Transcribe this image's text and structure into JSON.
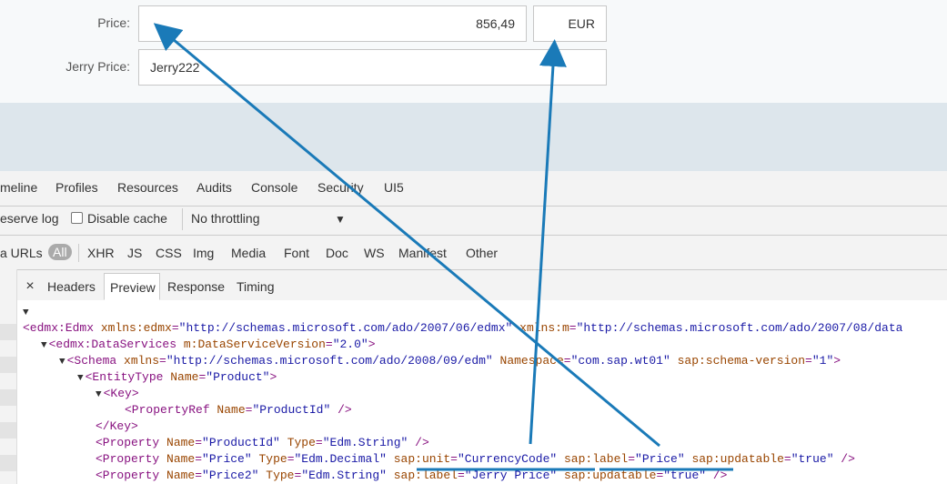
{
  "form": {
    "price_label": "Price:",
    "price_value": "856,49",
    "currency_value": "EUR",
    "jerry_price_label": "Jerry Price:",
    "jerry_price_value": "Jerry222"
  },
  "devtools": {
    "panel_tabs": [
      "meline",
      "Profiles",
      "Resources",
      "Audits",
      "Console",
      "Security",
      "UI5"
    ],
    "toolbar": {
      "preserve_log": "eserve log",
      "disable_cache": "Disable cache",
      "throttling": "No throttling",
      "dropdown_glyph": "▼"
    },
    "filters": {
      "data_urls": "a URLs",
      "all": "All",
      "types": [
        "XHR",
        "JS",
        "CSS",
        "Img",
        "Media",
        "Font",
        "Doc",
        "WS",
        "Manifest",
        "Other"
      ]
    },
    "detail_tabs": {
      "close_glyph": "×",
      "headers": "Headers",
      "preview": "Preview",
      "response": "Response",
      "timing": "Timing"
    }
  },
  "xml_lines": [
    {
      "indent": 0,
      "tri": "▼",
      "parts": []
    },
    {
      "indent": 0,
      "tri": "",
      "parts": [
        {
          "c": "tag",
          "t": "<edmx:Edmx "
        },
        {
          "c": "an",
          "t": "xmlns:edmx"
        },
        {
          "c": "tag",
          "t": "="
        },
        {
          "c": "av",
          "t": "\"http://schemas.microsoft.com/ado/2007/06/edmx\""
        },
        {
          "c": "tag",
          "t": " "
        },
        {
          "c": "an",
          "t": "xmlns:m"
        },
        {
          "c": "tag",
          "t": "="
        },
        {
          "c": "av",
          "t": "\"http://schemas.microsoft.com/ado/2007/08/data"
        }
      ]
    },
    {
      "indent": 1,
      "tri": "▼",
      "parts": [
        {
          "c": "tag",
          "t": "<edmx:DataServices "
        },
        {
          "c": "an",
          "t": "m:DataServiceVersion"
        },
        {
          "c": "tag",
          "t": "="
        },
        {
          "c": "av",
          "t": "\"2.0\""
        },
        {
          "c": "tag",
          "t": ">"
        }
      ]
    },
    {
      "indent": 2,
      "tri": "▼",
      "parts": [
        {
          "c": "tag",
          "t": "<Schema "
        },
        {
          "c": "an",
          "t": "xmlns"
        },
        {
          "c": "tag",
          "t": "="
        },
        {
          "c": "av",
          "t": "\"http://schemas.microsoft.com/ado/2008/09/edm\""
        },
        {
          "c": "tag",
          "t": " "
        },
        {
          "c": "an",
          "t": "Namespace"
        },
        {
          "c": "tag",
          "t": "="
        },
        {
          "c": "av",
          "t": "\"com.sap.wt01\""
        },
        {
          "c": "tag",
          "t": " "
        },
        {
          "c": "an",
          "t": "sap:schema-version"
        },
        {
          "c": "tag",
          "t": "="
        },
        {
          "c": "av",
          "t": "\"1\""
        },
        {
          "c": "tag",
          "t": ">"
        }
      ]
    },
    {
      "indent": 3,
      "tri": "▼",
      "parts": [
        {
          "c": "tag",
          "t": "<EntityType "
        },
        {
          "c": "an",
          "t": "Name"
        },
        {
          "c": "tag",
          "t": "="
        },
        {
          "c": "av",
          "t": "\"Product\""
        },
        {
          "c": "tag",
          "t": ">"
        }
      ]
    },
    {
      "indent": 4,
      "tri": "▼",
      "parts": [
        {
          "c": "tag",
          "t": "<Key>"
        }
      ]
    },
    {
      "indent": 5,
      "tri": "",
      "parts": [
        {
          "c": "tag",
          "t": "<PropertyRef "
        },
        {
          "c": "an",
          "t": "Name"
        },
        {
          "c": "tag",
          "t": "="
        },
        {
          "c": "av",
          "t": "\"ProductId\""
        },
        {
          "c": "tag",
          "t": " />"
        }
      ]
    },
    {
      "indent": 4,
      "tri": "",
      "parts": [
        {
          "c": "tag",
          "t": "</Key>"
        }
      ]
    },
    {
      "indent": 4,
      "tri": "",
      "parts": [
        {
          "c": "tag",
          "t": "<Property "
        },
        {
          "c": "an",
          "t": "Name"
        },
        {
          "c": "tag",
          "t": "="
        },
        {
          "c": "av",
          "t": "\"ProductId\""
        },
        {
          "c": "tag",
          "t": " "
        },
        {
          "c": "an",
          "t": "Type"
        },
        {
          "c": "tag",
          "t": "="
        },
        {
          "c": "av",
          "t": "\"Edm.String\""
        },
        {
          "c": "tag",
          "t": " />"
        }
      ]
    },
    {
      "indent": 4,
      "tri": "",
      "parts": [
        {
          "c": "tag",
          "t": "<Property "
        },
        {
          "c": "an",
          "t": "Name"
        },
        {
          "c": "tag",
          "t": "="
        },
        {
          "c": "av",
          "t": "\"Price\""
        },
        {
          "c": "tag",
          "t": " "
        },
        {
          "c": "an",
          "t": "Type"
        },
        {
          "c": "tag",
          "t": "="
        },
        {
          "c": "av",
          "t": "\"Edm.Decimal\""
        },
        {
          "c": "tag",
          "t": " "
        },
        {
          "c": "an",
          "t": "sap:unit"
        },
        {
          "c": "tag",
          "t": "="
        },
        {
          "c": "av",
          "t": "\"CurrencyCode\""
        },
        {
          "c": "tag",
          "t": " "
        },
        {
          "c": "an",
          "t": "sap:label"
        },
        {
          "c": "tag",
          "t": "="
        },
        {
          "c": "av",
          "t": "\"Price\""
        },
        {
          "c": "tag",
          "t": " "
        },
        {
          "c": "an",
          "t": "sap:updatable"
        },
        {
          "c": "tag",
          "t": "="
        },
        {
          "c": "av",
          "t": "\"true\""
        },
        {
          "c": "tag",
          "t": " />"
        }
      ]
    },
    {
      "indent": 4,
      "tri": "",
      "parts": [
        {
          "c": "tag",
          "t": "<Property "
        },
        {
          "c": "an",
          "t": "Name"
        },
        {
          "c": "tag",
          "t": "="
        },
        {
          "c": "av",
          "t": "\"Price2\""
        },
        {
          "c": "tag",
          "t": " "
        },
        {
          "c": "an",
          "t": "Type"
        },
        {
          "c": "tag",
          "t": "="
        },
        {
          "c": "av",
          "t": "\"Edm.String\""
        },
        {
          "c": "tag",
          "t": " "
        },
        {
          "c": "an",
          "t": "sap:label"
        },
        {
          "c": "tag",
          "t": "="
        },
        {
          "c": "av",
          "t": "\"Jerry Price\""
        },
        {
          "c": "tag",
          "t": " "
        },
        {
          "c": "an",
          "t": "sap:updatable"
        },
        {
          "c": "tag",
          "t": "="
        },
        {
          "c": "av",
          "t": "\"true\""
        },
        {
          "c": "tag",
          "t": " />"
        }
      ]
    }
  ],
  "colors": {
    "annotation": "#1a7ab8",
    "tag": "#881280",
    "attr_name": "#994500",
    "attr_value": "#1a1aa6"
  }
}
